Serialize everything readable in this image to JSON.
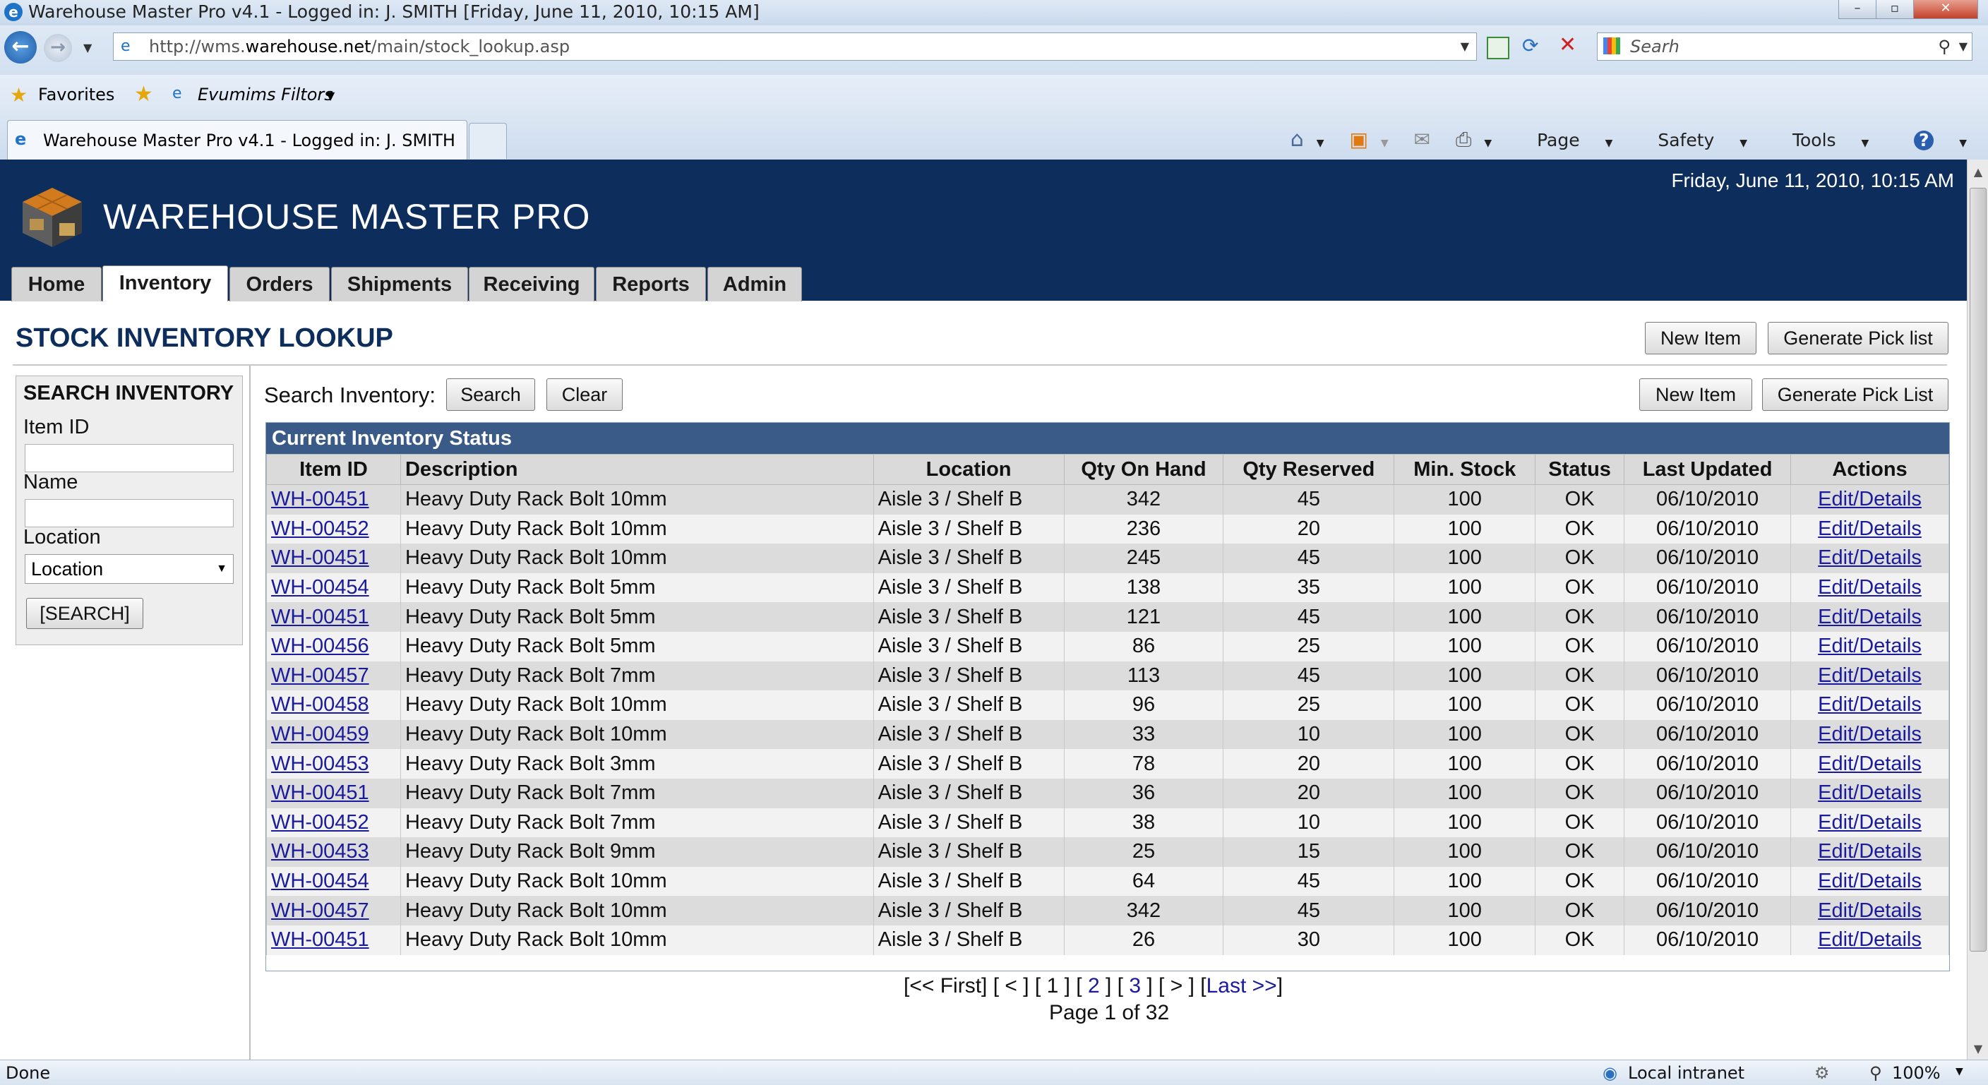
{
  "window": {
    "title": "Warehouse Master Pro v4.1 - Logged in: J. SMITH [Friday, June 11, 2010, 10:15 AM]"
  },
  "browser": {
    "address_prefix": "http://wms.",
    "address_domain": "warehouse.net",
    "address_path": "/main/stock_lookup.asp",
    "search_placeholder": "Searh",
    "favorites_label": "Favorites",
    "filters_label": "Evumims Filtors",
    "tab_title": "Warehouse Master Pro v4.1 - Logged in: J. SMITH",
    "cmd": {
      "page": "Page",
      "safety": "Safety",
      "tools": "Tools"
    }
  },
  "app": {
    "title": "WAREHOUSE MASTER PRO",
    "datetime": "Friday, June 11, 2010, 10:15 AM",
    "tabs": [
      "Home",
      "Inventory",
      "Orders",
      "Shipments",
      "Receiving",
      "Reports",
      "Admin"
    ],
    "active_tab": "Inventory"
  },
  "page": {
    "heading": "STOCK INVENTORY LOOKUP",
    "top_buttons": {
      "new_item": "New Item",
      "pick_list": "Generate Pick list"
    },
    "table_buttons": {
      "new_item": "New Item",
      "pick_list": "Generate Pick List"
    }
  },
  "search_panel": {
    "heading": "SEARCH INVENTORY",
    "item_id_label": "Item ID",
    "name_label": "Name",
    "location_label": "Location",
    "location_selected": "Location",
    "search_button": "[SEARCH]"
  },
  "search_bar": {
    "label": "Search Inventory:",
    "search_button": "Search",
    "clear_button": "Clear"
  },
  "table": {
    "caption": "Current Inventory Status",
    "columns": [
      "Item ID",
      "Description",
      "Location",
      "Qty On Hand",
      "Qty Reserved",
      "Min. Stock",
      "Status",
      "Last Updated",
      "Actions"
    ],
    "rows": [
      [
        "WH-00451",
        "Heavy Duty Rack Bolt 10mm",
        "Aisle 3 / Shelf B",
        "342",
        "45",
        "100",
        "OK",
        "06/10/2010",
        "Edit/Details"
      ],
      [
        "WH-00452",
        "Heavy Duty Rack Bolt 10mm",
        "Aisle 3 / Shelf B",
        "236",
        "20",
        "100",
        "OK",
        "06/10/2010",
        "Edit/Details"
      ],
      [
        "WH-00451",
        "Heavy Duty Rack Bolt 10mm",
        "Aisle 3 / Shelf B",
        "245",
        "45",
        "100",
        "OK",
        "06/10/2010",
        "Edit/Details"
      ],
      [
        "WH-00454",
        "Heavy Duty Rack Bolt 5mm",
        "Aisle 3 / Shelf B",
        "138",
        "35",
        "100",
        "OK",
        "06/10/2010",
        "Edit/Details"
      ],
      [
        "WH-00451",
        "Heavy Duty Rack Bolt 5mm",
        "Aisle 3 / Shelf B",
        "121",
        "45",
        "100",
        "OK",
        "06/10/2010",
        "Edit/Details"
      ],
      [
        "WH-00456",
        "Heavy Duty Rack Bolt 5mm",
        "Aisle 3 / Shelf B",
        "86",
        "25",
        "100",
        "OK",
        "06/10/2010",
        "Edit/Details"
      ],
      [
        "WH-00457",
        "Heavy Duty Rack Bolt 7mm",
        "Aisle 3 / Shelf B",
        "113",
        "45",
        "100",
        "OK",
        "06/10/2010",
        "Edit/Details"
      ],
      [
        "WH-00458",
        "Heavy Duty Rack Bolt 10mm",
        "Aisle 3 / Shelf B",
        "96",
        "25",
        "100",
        "OK",
        "06/10/2010",
        "Edit/Details"
      ],
      [
        "WH-00459",
        "Heavy Duty Rack Bolt 10mm",
        "Aisle 3 / Shelf B",
        "33",
        "10",
        "100",
        "OK",
        "06/10/2010",
        "Edit/Details"
      ],
      [
        "WH-00453",
        "Heavy Duty Rack Bolt 3mm",
        "Aisle 3 / Shelf B",
        "78",
        "20",
        "100",
        "OK",
        "06/10/2010",
        "Edit/Details"
      ],
      [
        "WH-00451",
        "Heavy Duty Rack Bolt 7mm",
        "Aisle 3 / Shelf B",
        "36",
        "20",
        "100",
        "OK",
        "06/10/2010",
        "Edit/Details"
      ],
      [
        "WH-00452",
        "Heavy Duty Rack Bolt 7mm",
        "Aisle 3 / Shelf B",
        "38",
        "10",
        "100",
        "OK",
        "06/10/2010",
        "Edit/Details"
      ],
      [
        "WH-00453",
        "Heavy Duty Rack Bolt 9mm",
        "Aisle 3 / Shelf B",
        "25",
        "15",
        "100",
        "OK",
        "06/10/2010",
        "Edit/Details"
      ],
      [
        "WH-00454",
        "Heavy Duty Rack Bolt 10mm",
        "Aisle 3 / Shelf B",
        "64",
        "45",
        "100",
        "OK",
        "06/10/2010",
        "Edit/Details"
      ],
      [
        "WH-00457",
        "Heavy Duty Rack Bolt 10mm",
        "Aisle 3 / Shelf B",
        "342",
        "45",
        "100",
        "OK",
        "06/10/2010",
        "Edit/Details"
      ],
      [
        "WH-00451",
        "Heavy Duty Rack Bolt 10mm",
        "Aisle 3 / Shelf B",
        "26",
        "30",
        "100",
        "OK",
        "06/10/2010",
        "Edit/Details"
      ]
    ]
  },
  "pagination": {
    "first": "<< First",
    "prev": "<",
    "pages": [
      "1",
      "2",
      "3"
    ],
    "next": ">",
    "last": "Last >>",
    "info": "Page 1 of 32"
  },
  "statusbar": {
    "status": "Done",
    "zone": "Local intranet",
    "zoom": "100%"
  },
  "colors": {
    "header_bg": "#0d2d5c",
    "caption_bg": "#3a5b88",
    "link": "#1a1a9c"
  },
  "icons": [
    "ie-logo-icon",
    "back-icon",
    "forward-icon",
    "compat-view-icon",
    "refresh-icon",
    "stop-icon",
    "search-icon",
    "favorites-star-icon",
    "add-favorites-icon",
    "home-icon",
    "feeds-icon",
    "mail-icon",
    "print-icon",
    "help-icon",
    "warehouse-logo-icon",
    "local-intranet-icon",
    "zoom-icon"
  ]
}
